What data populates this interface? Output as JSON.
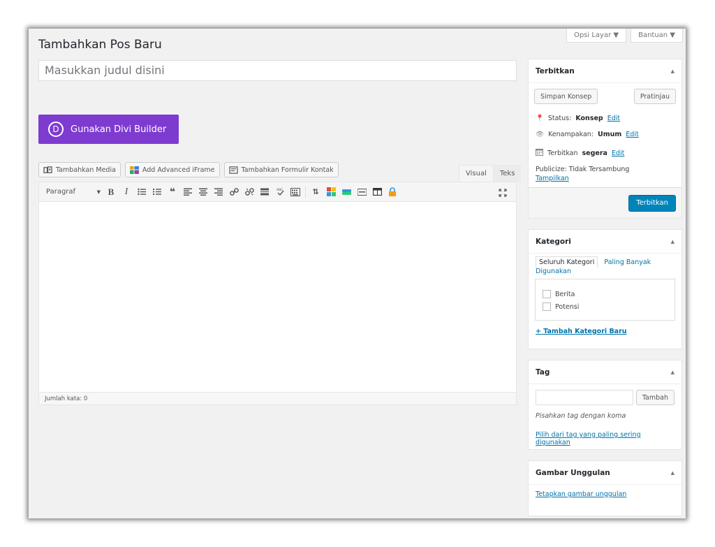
{
  "screen_options": {
    "options_label": "Opsi Layar ▼",
    "help_label": "Bantuan ▼"
  },
  "page": {
    "title": "Tambahkan Pos Baru"
  },
  "post_title": {
    "placeholder": "Masukkan judul disini"
  },
  "divi": {
    "logo": "D",
    "label": "Gunakan Divi Builder"
  },
  "media_buttons": {
    "add_media": "Tambahkan Media",
    "add_iframe": "Add Advanced iFrame",
    "add_form": "Tambahkan Formulir Kontak"
  },
  "editor_tabs": {
    "visual": "Visual",
    "text": "Teks"
  },
  "toolbar": {
    "format": "Paragraf",
    "bold": "B",
    "italic": "I"
  },
  "status_bar": {
    "word_count": "Jumlah kata: 0"
  },
  "publish": {
    "title": "Terbitkan",
    "save_draft": "Simpan Konsep",
    "preview": "Pratinjau",
    "status_label": "Status:",
    "status_value": "Konsep",
    "visibility_label": "Kenampakan:",
    "visibility_value": "Umum",
    "schedule_label": "Terbitkan",
    "schedule_value": "segera",
    "edit": "Edit",
    "publicize": "Publicize: Tidak Tersambung",
    "show": "Tampilkan",
    "publish_button": "Terbitkan"
  },
  "categories": {
    "title": "Kategori",
    "tab_all": "Seluruh Kategori",
    "tab_popular": "Paling Banyak Digunakan",
    "items": [
      "Berita",
      "Potensi"
    ],
    "add_new": "+ Tambah Kategori Baru"
  },
  "tags": {
    "title": "Tag",
    "add_button": "Tambah",
    "hint": "Pisahkan tag dengan koma",
    "choose_link": "Pilih dari tag yang paling sering digunakan"
  },
  "featured_image": {
    "title": "Gambar Unggulan",
    "set_link": "Tetapkan gambar unggulan"
  },
  "colors": {
    "divi": "#7e3bd0",
    "primary": "#0085ba",
    "link": "#0073aa"
  }
}
